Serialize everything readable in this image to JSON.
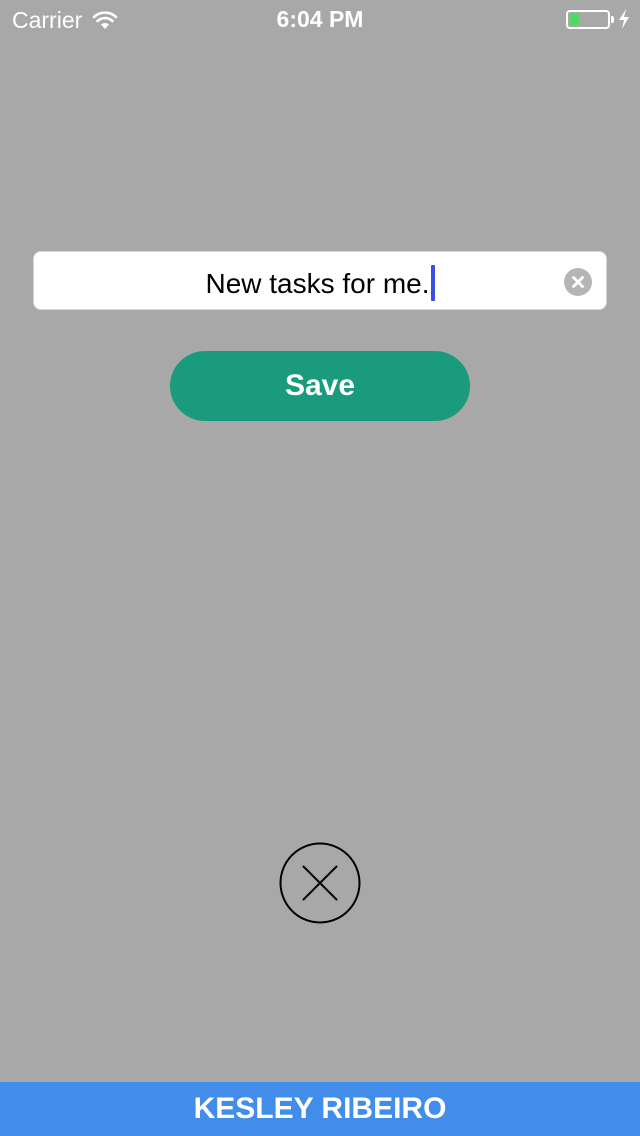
{
  "status_bar": {
    "carrier": "Carrier",
    "time": "6:04 PM",
    "battery_level": 0.25,
    "battery_color": "#4cd964",
    "wifi_icon": "wifi-icon",
    "charging_icon": "bolt-icon"
  },
  "task_field": {
    "value": "New tasks for me.",
    "caret_color": "#3b4fe0",
    "clear_icon": "clear-icon"
  },
  "save_button": {
    "label": "Save",
    "color": "#1a9b7e"
  },
  "close_button": {
    "icon": "close-icon"
  },
  "footer": {
    "text": "KESLEY RIBEIRO",
    "color": "#418de9"
  },
  "background_color": "#a8a8a8"
}
